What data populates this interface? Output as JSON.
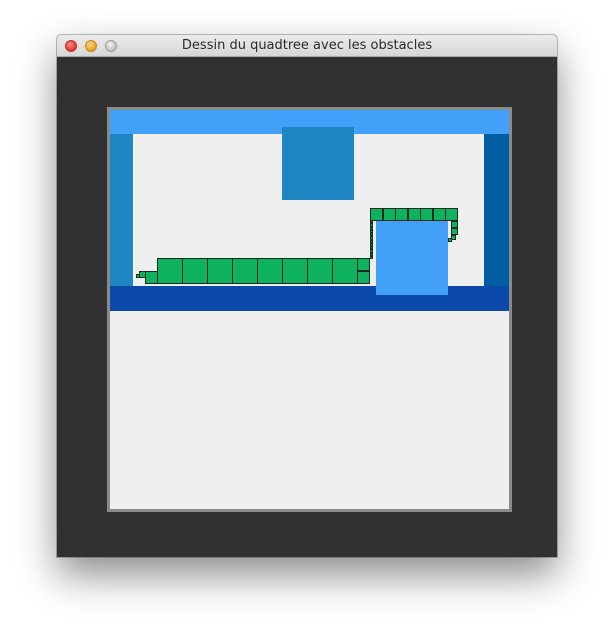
{
  "window": {
    "title": "Dessin du quadtree avec les obstacles",
    "background": "#313131"
  },
  "canvas": {
    "background": "#efefef",
    "obstacle_colors": {
      "light_blue": "#43a0f8",
      "medium_blue": "#1e87c3",
      "dark_blue": "#005da2",
      "navy": "#0b4aaa"
    },
    "cell_color": "#0eb15d",
    "cell_outline": "#1a2a1f"
  }
}
